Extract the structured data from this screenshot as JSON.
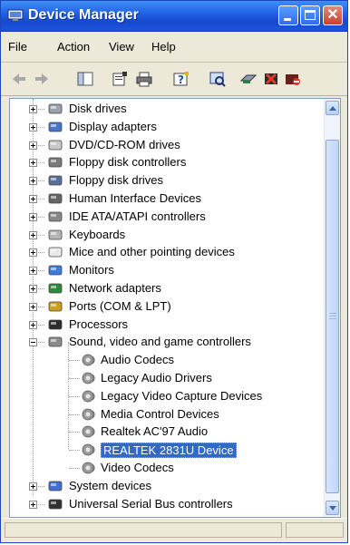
{
  "window": {
    "title": "Device Manager",
    "controls": {
      "minimize": "minimize",
      "maximize": "maximize",
      "close": "close"
    }
  },
  "menu": [
    "File",
    "Action",
    "View",
    "Help"
  ],
  "toolbar": {
    "buttons": [
      "back-arrow-icon",
      "forward-arrow-icon",
      "console-tree-icon",
      "properties-icon",
      "print-icon",
      "help-icon",
      "scan-hardware-icon",
      "update-driver-icon",
      "uninstall-icon",
      "disable-icon"
    ]
  },
  "tree": {
    "categories": [
      {
        "label": "Disk drives",
        "icon": "disk-drive-icon",
        "expanded": false
      },
      {
        "label": "Display adapters",
        "icon": "display-adapter-icon",
        "expanded": false
      },
      {
        "label": "DVD/CD-ROM drives",
        "icon": "cdrom-icon",
        "expanded": false
      },
      {
        "label": "Floppy disk controllers",
        "icon": "floppy-controller-icon",
        "expanded": false
      },
      {
        "label": "Floppy disk drives",
        "icon": "floppy-drive-icon",
        "expanded": false
      },
      {
        "label": "Human Interface Devices",
        "icon": "hid-icon",
        "expanded": false
      },
      {
        "label": "IDE ATA/ATAPI controllers",
        "icon": "ide-controller-icon",
        "expanded": false
      },
      {
        "label": "Keyboards",
        "icon": "keyboard-icon",
        "expanded": false
      },
      {
        "label": "Mice and other pointing devices",
        "icon": "mouse-icon",
        "expanded": false
      },
      {
        "label": "Monitors",
        "icon": "monitor-icon",
        "expanded": false
      },
      {
        "label": "Network adapters",
        "icon": "network-adapter-icon",
        "expanded": false
      },
      {
        "label": "Ports (COM & LPT)",
        "icon": "port-icon",
        "expanded": false
      },
      {
        "label": "Processors",
        "icon": "processor-icon",
        "expanded": false
      },
      {
        "label": "Sound, video and game controllers",
        "icon": "sound-icon",
        "expanded": true
      },
      {
        "label": "System devices",
        "icon": "system-device-icon",
        "expanded": false
      },
      {
        "label": "Universal Serial Bus controllers",
        "icon": "usb-icon",
        "expanded": false
      }
    ],
    "sound_children": [
      {
        "label": "Audio Codecs",
        "selected": false
      },
      {
        "label": "Legacy Audio Drivers",
        "selected": false
      },
      {
        "label": "Legacy Video Capture Devices",
        "selected": false
      },
      {
        "label": "Media Control Devices",
        "selected": false
      },
      {
        "label": "Realtek AC'97 Audio",
        "selected": false
      },
      {
        "label": "REALTEK 2831U Device",
        "selected": true
      },
      {
        "label": "Video Codecs",
        "selected": false
      }
    ]
  },
  "colors": {
    "titlebar": "#1f5fe3",
    "selection": "#316ac5",
    "window_bg": "#ece9d8"
  }
}
